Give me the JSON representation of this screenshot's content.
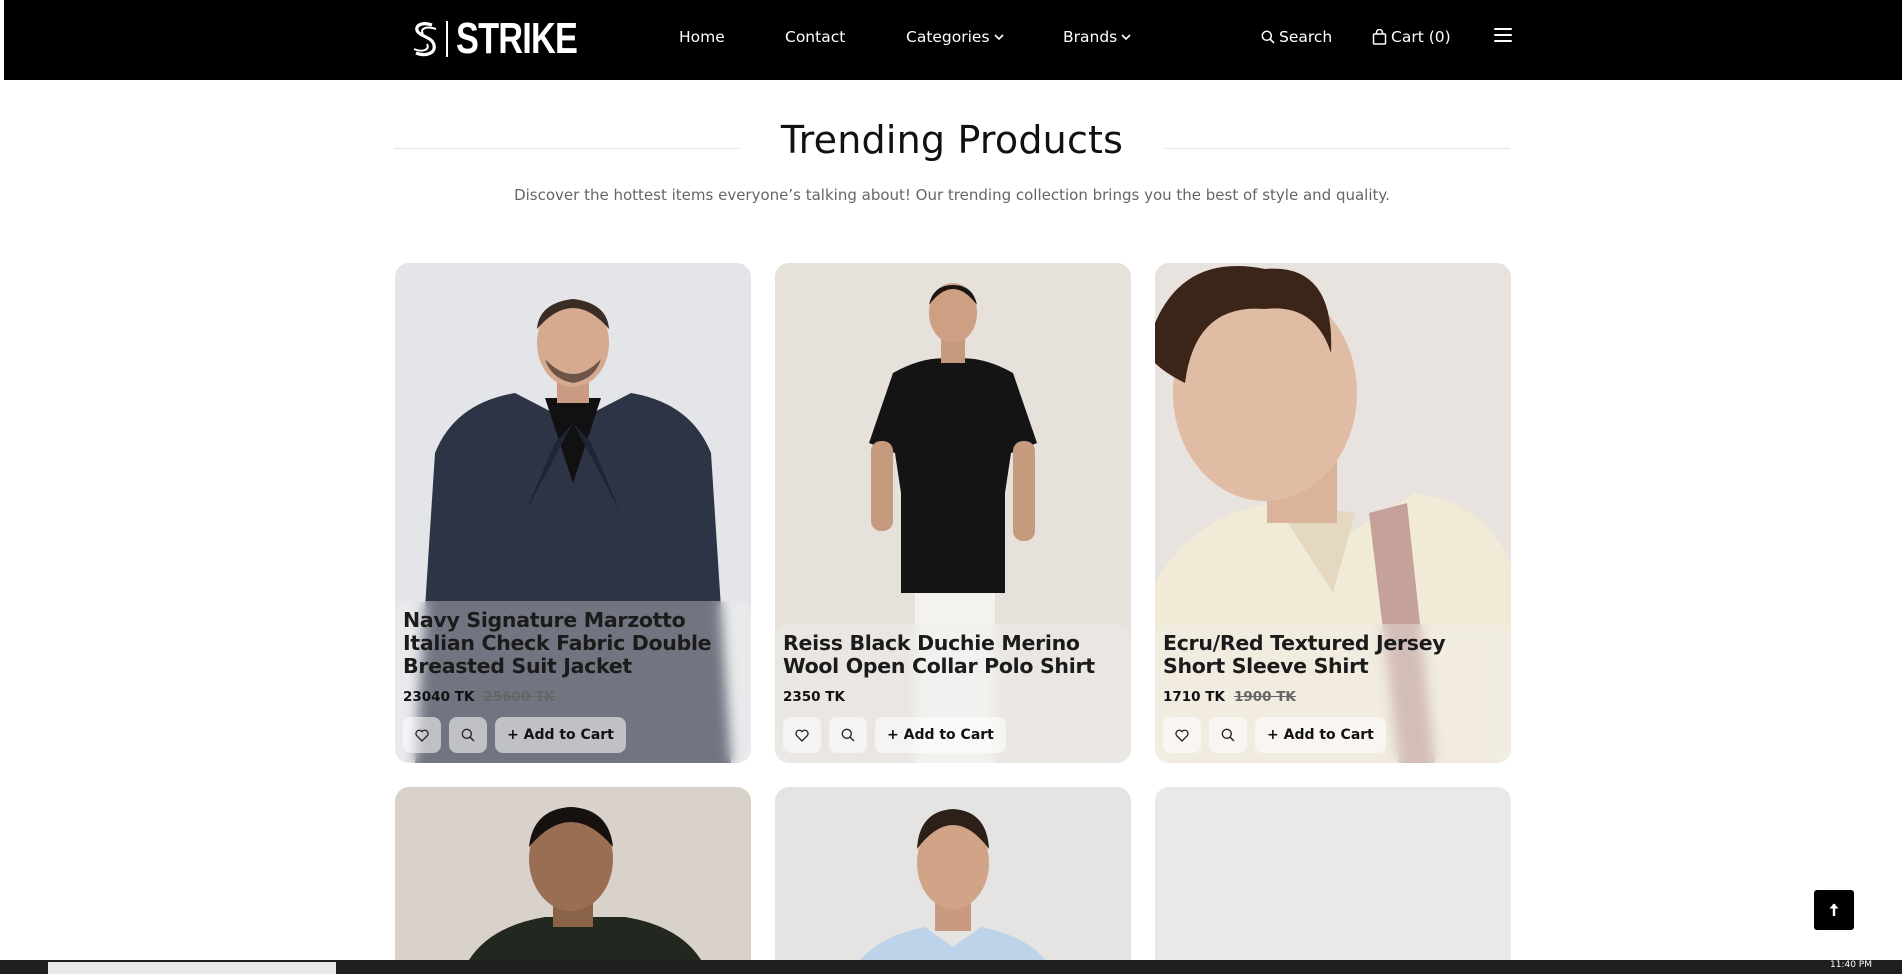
{
  "brand": {
    "name": "STRIKE"
  },
  "nav": {
    "links": [
      "Home",
      "Contact",
      "Categories",
      "Brands"
    ],
    "search_label": "Search",
    "cart_label": "Cart (0)"
  },
  "section": {
    "title": "Trending Products",
    "subtitle": "Discover the hottest items everyone’s talking about! Our trending collection brings you the best of style and quality."
  },
  "products": [
    {
      "name": "Navy Signature Marzotto Italian Check Fabric Double Breasted Suit Jacket",
      "price": "23040 TK",
      "old_price": "25600 TK",
      "add_label": "+ Add to Cart"
    },
    {
      "name": "Reiss Black Duchie Merino Wool Open Collar Polo Shirt",
      "price": "2350 TK",
      "old_price": "",
      "add_label": "+ Add to Cart"
    },
    {
      "name": "Ecru/Red Textured Jersey Short Sleeve Shirt",
      "price": "1710 TK",
      "old_price": "1900 TK",
      "add_label": "+ Add to Cart"
    }
  ],
  "taskbar": {
    "time": "11:40 PM"
  }
}
